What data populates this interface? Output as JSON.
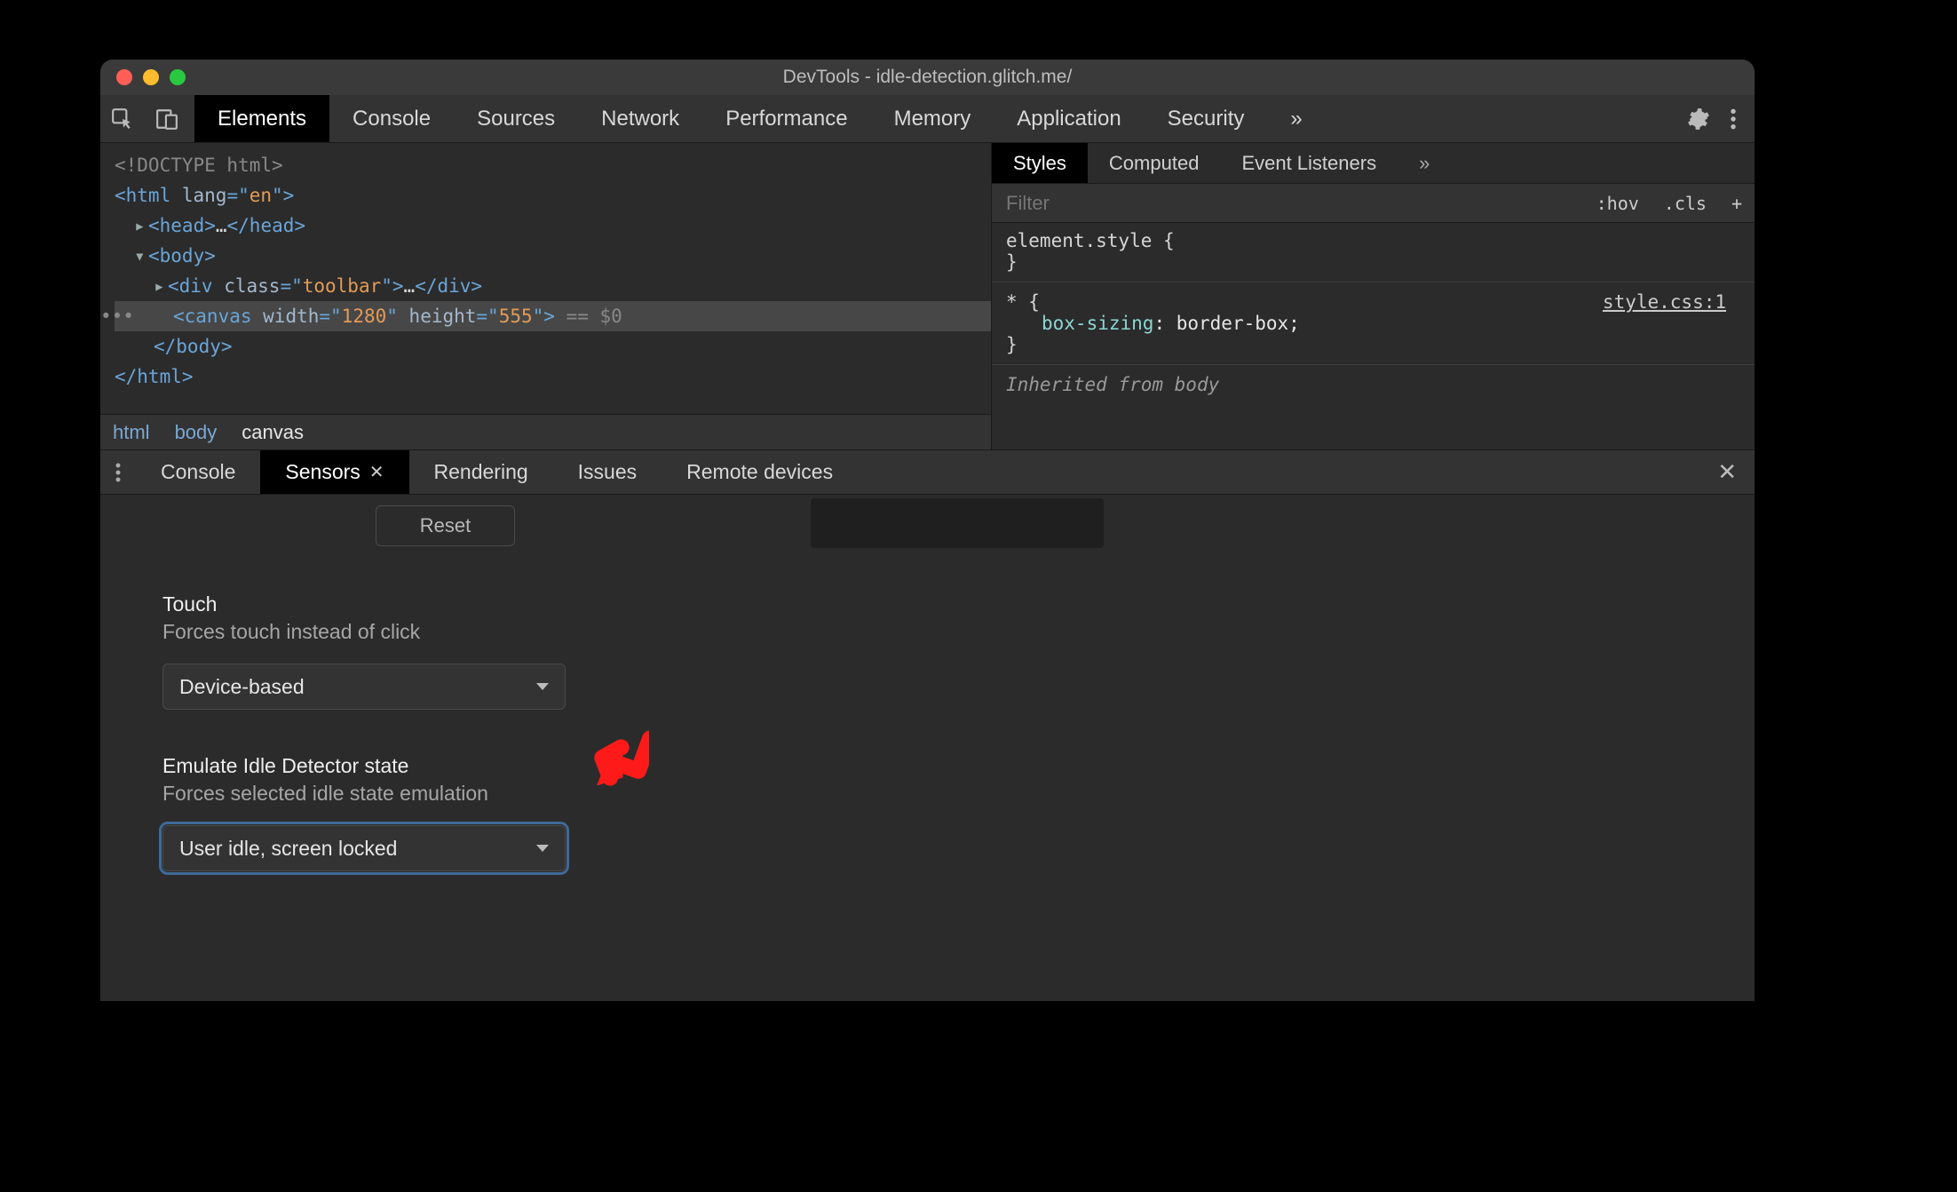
{
  "window_title": "DevTools - idle-detection.glitch.me/",
  "toolbar_tabs": [
    "Elements",
    "Console",
    "Sources",
    "Network",
    "Performance",
    "Memory",
    "Application",
    "Security"
  ],
  "toolbar_active": "Elements",
  "dom": {
    "doctype": "<!DOCTYPE html>",
    "html_open_pre": "<html ",
    "html_lang_name": "lang",
    "html_lang_eq": "=\"",
    "html_lang_val": "en",
    "html_open_post": "\">",
    "head_open": "<head>",
    "head_ellipsis": "…",
    "head_close": "</head>",
    "body_open": "<body>",
    "div_open_pre": "<div ",
    "div_class_name": "class",
    "div_class_eq": "=\"",
    "div_class_val": "toolbar",
    "div_open_post": "\">",
    "div_ellipsis": "…",
    "div_close": "</div>",
    "canvas_open_pre": "<canvas ",
    "canvas_w_name": "width",
    "canvas_w_eq": "=\"",
    "canvas_w_val": "1280",
    "canvas_w_post": "\" ",
    "canvas_h_name": "height",
    "canvas_h_eq": "=\"",
    "canvas_h_val": "555",
    "canvas_open_post": "\">",
    "canvas_eq0": " == $0",
    "body_close": "</body>",
    "html_close": "</html>"
  },
  "breadcrumbs": [
    "html",
    "body",
    "canvas"
  ],
  "breadcrumb_current": "canvas",
  "styles_tabs": [
    "Styles",
    "Computed",
    "Event Listeners"
  ],
  "styles_active": "Styles",
  "filter_placeholder": "Filter",
  "filter_controls": {
    "hov": ":hov",
    "cls": ".cls",
    "plus": "+"
  },
  "styles_rules": {
    "element_style_sel": "element.style {",
    "element_style_close": "}",
    "star_sel": "* {",
    "star_link": "style.css:1",
    "star_prop": "box-sizing",
    "star_val": "border-box",
    "star_close": "}",
    "inherited_label": "Inherited from ",
    "inherited_tag": "body"
  },
  "drawer_tabs": [
    "Console",
    "Sensors",
    "Rendering",
    "Issues",
    "Remote devices"
  ],
  "drawer_active": "Sensors",
  "reset_label": "Reset",
  "touch": {
    "title": "Touch",
    "desc": "Forces touch instead of click",
    "value": "Device-based"
  },
  "idle": {
    "title": "Emulate Idle Detector state",
    "desc": "Forces selected idle state emulation",
    "value": "User idle, screen locked"
  }
}
